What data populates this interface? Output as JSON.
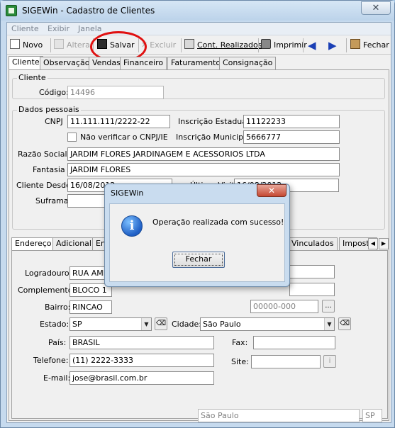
{
  "window": {
    "title": "SIGEWin - Cadastro de Clientes",
    "close_glyph": "✕"
  },
  "menu": [
    "Cliente",
    "Exibir",
    "Janela"
  ],
  "toolbar": {
    "novo": "Novo",
    "alterar": "Alterar",
    "salvar": "Salvar",
    "excluir": "Excluir",
    "cont_realizados": "Cont. Realizados",
    "imprimir": "Imprimir",
    "fechar": "Fechar"
  },
  "main_tabs": [
    "Cliente",
    "Observação",
    "Vendas",
    "Financeiro",
    "Faturamento",
    "Consignação"
  ],
  "cliente_group": {
    "title": "Cliente",
    "codigo_label": "Código:",
    "codigo": "14496"
  },
  "dados_pessoais": {
    "title": "Dados pessoais",
    "cnpj_label": "CNPJ",
    "cnpj": "11.111.111/2222-22",
    "ie_label": "Inscrição Estadual",
    "ie": "11122233",
    "nao_verificar": "Não verificar o CNPJ/IE",
    "im_label": "Inscrição Municipal",
    "im": "5666777",
    "razao_label": "Razão Social",
    "razao": "JARDIM FLORES JARDINAGEM E ACESSORIOS LTDA",
    "fantasia_label": "Fantasia",
    "fantasia": "JARDIM FLORES",
    "desde_label": "Cliente Desde",
    "desde": "16/08/2012",
    "ultima_label": "Última Visita",
    "ultima": "16/08/2012",
    "suframa_label": "Suframa",
    "suframa": ""
  },
  "sub_tabs": [
    "Endereço",
    "Adicional",
    "En",
    "Vinculados",
    "Imposto"
  ],
  "endereco": {
    "logradouro_label": "Logradouro:",
    "logradouro": "RUA AME",
    "complemento_label": "Complemento:",
    "complemento": "BLOCO 1",
    "bairro_label": "Bairro:",
    "bairro": "RINCAO",
    "cep_value": "00000-000",
    "estado_label": "Estado:",
    "estado": "SP",
    "cidade_label": "Cidade:",
    "cidade": "São Paulo",
    "pais_label": "País:",
    "pais": "BRASIL",
    "fax_label": "Fax:",
    "fax": "",
    "telefone_label": "Telefone:",
    "telefone": "(11) 2222-3333",
    "site_label": "Site:",
    "site": "",
    "email_label": "E-mail:",
    "email": "jose@brasil.com.br",
    "cidade_ro": "São Paulo",
    "uf_ro": "SP"
  },
  "dialog": {
    "title": "SIGEWin",
    "message": "Operação realizada com sucesso!",
    "button": "Fechar",
    "close_glyph": "✕",
    "icon_glyph": "i"
  }
}
